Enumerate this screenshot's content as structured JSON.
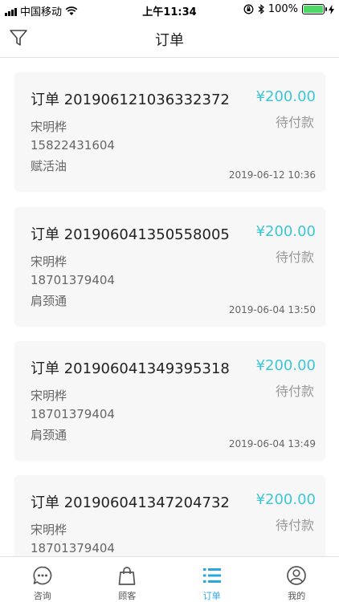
{
  "status_bar": {
    "carrier": "中国移动",
    "time": "上午11:34",
    "battery": "100%"
  },
  "nav": {
    "title": "订单"
  },
  "orders": [
    {
      "title": "订单 201906121036332372",
      "price": "¥200.00",
      "status": "待付款",
      "customer": "宋明桦",
      "phone": "15822431604",
      "product": "赋活油",
      "time": "2019-06-12 10:36"
    },
    {
      "title": "订单 201906041350558005",
      "price": "¥200.00",
      "status": "待付款",
      "customer": "宋明桦",
      "phone": "18701379404",
      "product": "肩颈通",
      "time": "2019-06-04 13:50"
    },
    {
      "title": "订单 201906041349395318",
      "price": "¥200.00",
      "status": "待付款",
      "customer": "宋明桦",
      "phone": "18701379404",
      "product": "肩颈通",
      "time": "2019-06-04 13:49"
    },
    {
      "title": "订单 201906041347204732",
      "price": "¥200.00",
      "status": "待付款",
      "customer": "宋明桦",
      "phone": "18701379404",
      "product": "",
      "time": ""
    }
  ],
  "tabs": [
    {
      "label": "咨询",
      "icon": "chat-bubble-icon"
    },
    {
      "label": "顾客",
      "icon": "shopping-bag-icon"
    },
    {
      "label": "订单",
      "icon": "list-icon"
    },
    {
      "label": "我的",
      "icon": "user-profile-icon"
    }
  ],
  "colors": {
    "accent": "#3cc7d6",
    "tab_active": "#29a8e0",
    "card_bg": "#f7f7f7"
  }
}
